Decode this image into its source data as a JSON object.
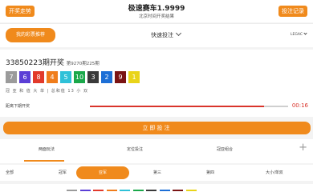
{
  "header": {
    "left_button": "开奖走势",
    "right_button": "投注记录",
    "title": "极速赛车1.9999",
    "subtitle": "北京时间开奖结果"
  },
  "tabbar": {
    "active_tab": "我的彩票推荐",
    "center_tab": "快速投注",
    "right_tab": "LEGAC"
  },
  "draw": {
    "number": "33850223",
    "number_suffix": "期开奖",
    "sub": "第9270期225期",
    "balls": [
      {
        "value": "7",
        "color": "#9b9b9b"
      },
      {
        "value": "6",
        "color": "#5b3fd6"
      },
      {
        "value": "8",
        "color": "#e23a2b"
      },
      {
        "value": "4",
        "color": "#f07d1c"
      },
      {
        "value": "5",
        "color": "#2fc1d8"
      },
      {
        "value": "10",
        "color": "#1aa84a"
      },
      {
        "value": "3",
        "color": "#3a3a3a"
      },
      {
        "value": "2",
        "color": "#1d6fd6"
      },
      {
        "value": "9",
        "color": "#7a1414"
      },
      {
        "value": "1",
        "color": "#e9d41a"
      }
    ],
    "stats": "冠 亚 和 值 大 单 | 总和值 13 小 双",
    "countdown_label": "距离下期开奖",
    "countdown": "00:16",
    "progress": 0.88
  },
  "bet_button": "立即投注",
  "subtabs": [
    "两面玩法",
    "定位投注",
    "冠亚组合"
  ],
  "filters": [
    "全部",
    "冠军",
    "亚军",
    "第三",
    "第四",
    "大小/单双"
  ],
  "active_filter": "亚军",
  "swatch_colors": [
    "#9b9b9b",
    "#5b3fd6",
    "#e23a2b",
    "#f07d1c",
    "#2fc1d8",
    "#1aa84a",
    "#3a3a3a",
    "#1d6fd6",
    "#7a1414",
    "#e9d41a"
  ],
  "colors": {
    "accent": "#f08a1c",
    "countdown": "#d9342b"
  }
}
